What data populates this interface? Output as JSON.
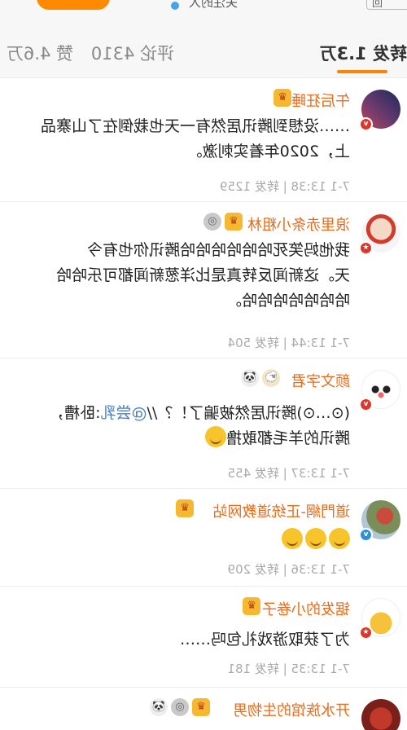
{
  "top": {
    "text": "关注的人",
    "button": "回"
  },
  "tabs": {
    "repost": "转发 1.3万",
    "comment": "评论 4310",
    "like": "赞 4.6万"
  },
  "colors": {
    "accent": "#ff8200",
    "username": "#e86c1a",
    "link": "#4b7fc0"
  },
  "items": [
    {
      "username": "午后狂睡",
      "badges": [
        "crown-icon"
      ],
      "text_lines": [
        "……没想到腾讯居然有一天也栽倒在了山寨品",
        "上，2020年着实刺激。"
      ],
      "time": "7-1 13:38",
      "repost": "转发 1259"
    },
    {
      "username": "浪里赤条小粗林",
      "badges": [
        "crown-icon",
        "medal-icon"
      ],
      "text_lines": [
        "我他妈笑死哈哈哈哈哈哈腾讯你也有今",
        "天。这新闻反转真是比洋葱新闻都可乐哈哈",
        "哈哈哈哈哈哈哈。"
      ],
      "time": "7-1 13:44",
      "repost": "转发 504"
    },
    {
      "username": "颜文字君",
      "badges": [
        "sheep-icon",
        "panda-icon"
      ],
      "text_pre": "(⊙…⊙)腾讯居然被骗了！？//",
      "link": "@尝乳",
      "text_post": ":卧槽，",
      "text_line2": "腾讯的羊毛都敢撸",
      "time": "7-1 13:37",
      "repost": "转发 455"
    },
    {
      "username": "道門網-正统道教网站",
      "badges": [
        "crown-icon"
      ],
      "time": "7-1 13:36",
      "repost": "转发 209"
    },
    {
      "username": "锯发的小卷子",
      "badges": [
        "crown-icon"
      ],
      "text_lines": [
        "为了获取游戏礼包吗……"
      ],
      "time": "7-1 13:35",
      "repost": "转发 181"
    },
    {
      "username": "开水族馆的生物男",
      "badges": [
        "crown-icon",
        "medal-icon",
        "panda-icon"
      ]
    }
  ]
}
